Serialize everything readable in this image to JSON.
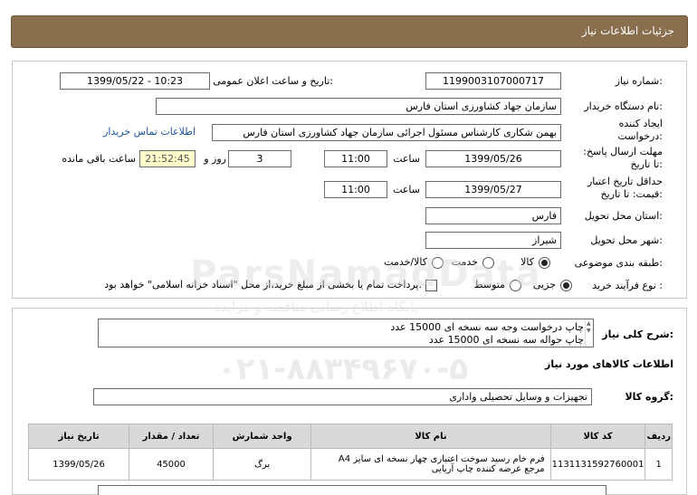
{
  "header": {
    "title": "جزئیات اطلاعات نیاز"
  },
  "form": {
    "need_number_label": "شماره نیاز:",
    "need_number": "1199003107000717",
    "announce_label": "تاریخ و ساعت اعلان عمومی:",
    "announce_value": "1399/05/22 - 10:23",
    "buyer_label": "نام دستگاه خریدار:",
    "buyer_value": "سازمان جهاد کشاورزی استان فارس",
    "creator_label": "ایجاد کننده درخواست:",
    "creator_value": "بهمن شکاری کارشناس مسئول اجرائی سازمان جهاد کشاورزی استان فارس",
    "contact_link": "اطلاعات تماس خریدار",
    "reply_label": "مهلت ارسال پاسخ: تا تاریخ:",
    "reply_date": "1399/05/26",
    "time_label": "ساعت",
    "reply_time": "11:00",
    "days_value": "3",
    "days_label": "روز و",
    "remaining_time": "21:52:45",
    "remaining_label": "ساعت باقی مانده",
    "validity_label": "حداقل تاریخ اعتبار قیمت: تا تاریخ:",
    "validity_date": "1399/05/27",
    "validity_time": "11:00",
    "province_label": "استان محل تحویل:",
    "province_value": "فارس",
    "city_label": "شهر محل تحویل:",
    "city_value": "شیراز",
    "category_label": "طبقه بندی موضوعی:",
    "category_options": [
      "کالا",
      "خدمت",
      "کالا/خدمت"
    ],
    "process_label": "نوع فرآیند خرید :",
    "process_options": [
      "جزیی",
      "متوسط"
    ],
    "payment_note": "پرداخت تمام یا بخشی از مبلغ خرید،از محل \"اسناد خزانه اسلامی\" خواهد بود."
  },
  "summary": {
    "label": "شرح کلی نیاز:",
    "lines": [
      "چاپ درخواست وجه سه نسخه ای 15000 عدد",
      "چاپ حواله سه نسخه ای 15000 عدد"
    ]
  },
  "goods": {
    "section_title": "اطلاعات کالاهای مورد نیاز",
    "group_label": "گروه کالا:",
    "group_value": "تجهیزات و وسایل تحصیلی واداری",
    "columns": [
      "ردیف",
      "کد کالا",
      "نام کالا",
      "واحد شمارش",
      "تعداد / مقدار",
      "تاریخ نیاز"
    ],
    "rows": [
      {
        "row": "1",
        "code": "1131131592760001",
        "name_line1": "فرم خام رسید سوخت اعتباری چهار نسخه ای سایز A4",
        "name_line2": "مرجع عرضه کننده چاپ آریایی",
        "unit": "برگ",
        "qty": "45000",
        "date": "1399/05/26"
      }
    ]
  },
  "watermark": {
    "brand": "ParsNamadData",
    "tagline": "پایگاه اطلاع رسانی مناقصه و مزایده",
    "phone": "۰۲۱-۸۸۳۴۹۶۷۰-۵"
  }
}
